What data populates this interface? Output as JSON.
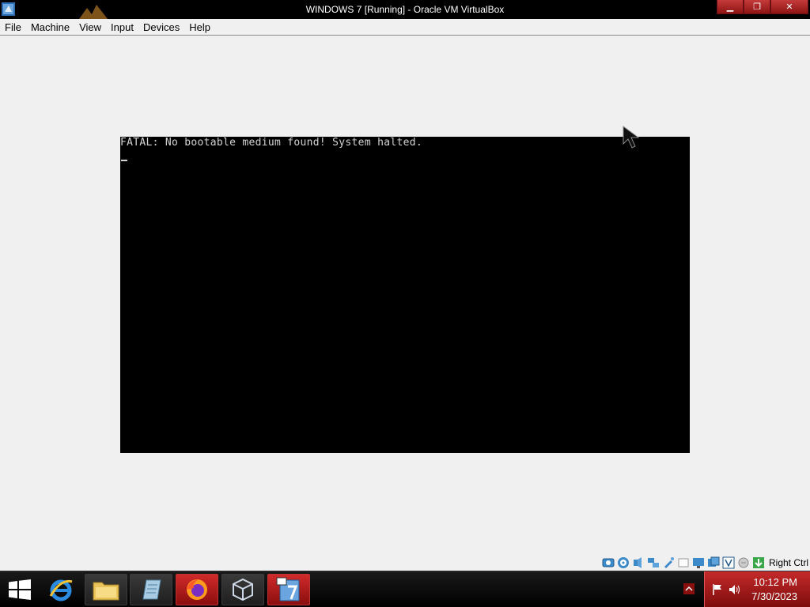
{
  "window": {
    "title": "WINDOWS 7 [Running] - Oracle VM VirtualBox",
    "minimize_glyph": "▁",
    "restore_glyph": "❐",
    "close_glyph": "✕"
  },
  "menubar": {
    "items": [
      "File",
      "Machine",
      "View",
      "Input",
      "Devices",
      "Help"
    ]
  },
  "vm_console": {
    "lines": [
      "FATAL: No bootable medium found! System halted."
    ],
    "cursor": "_"
  },
  "statusbar": {
    "icons": [
      "hard-disk-icon",
      "optical-drive-icon",
      "audio-icon",
      "network-icon",
      "usb-icon",
      "shared-folders-icon",
      "display-icon",
      "video-capture-icon",
      "virtualization-icon",
      "mouse-integration-icon",
      "keyboard-icon"
    ],
    "host_key": "Right Ctrl"
  },
  "taskbar": {
    "apps": [
      "internet-explorer-icon",
      "file-explorer-icon",
      "notepad-icon",
      "firefox-icon",
      "virtualbox-icon",
      "windows7-vm-icon"
    ],
    "clock_time": "10:12 PM",
    "clock_date": "7/30/2023",
    "colors": {
      "accent": "#b01818",
      "taskbar": "#000000"
    }
  }
}
